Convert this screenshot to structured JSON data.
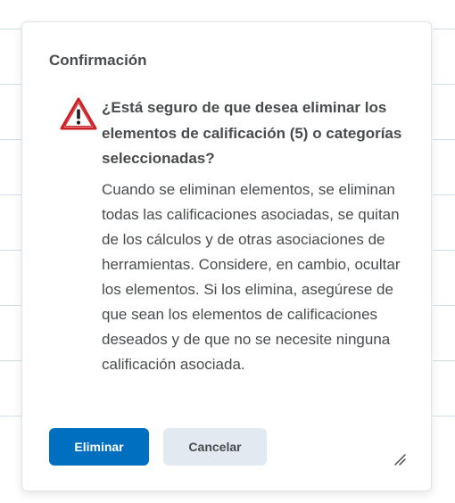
{
  "dialog": {
    "title": "Confirmación",
    "question": "¿Está seguro de que desea eliminar los elementos de calificación (5) o categorías seleccionadas?",
    "body": "Cuando se eliminan elementos, se eliminan todas las calificaciones asociadas, se quitan de los cálculos y de otras asociaciones de herramientas. Considere, en cambio, ocultar los elementos. Si los elimina, asegúrese de que sean los elementos de calificaciones deseados y de que no se necesite ninguna calificación asociada.",
    "icon": "warning-icon",
    "buttons": {
      "confirm_label": "Eliminar",
      "cancel_label": "Cancelar"
    }
  },
  "colors": {
    "primary": "#006fbf",
    "secondary": "#e3e9f1",
    "warning_red": "#cd2026",
    "text": "#494c4e"
  }
}
